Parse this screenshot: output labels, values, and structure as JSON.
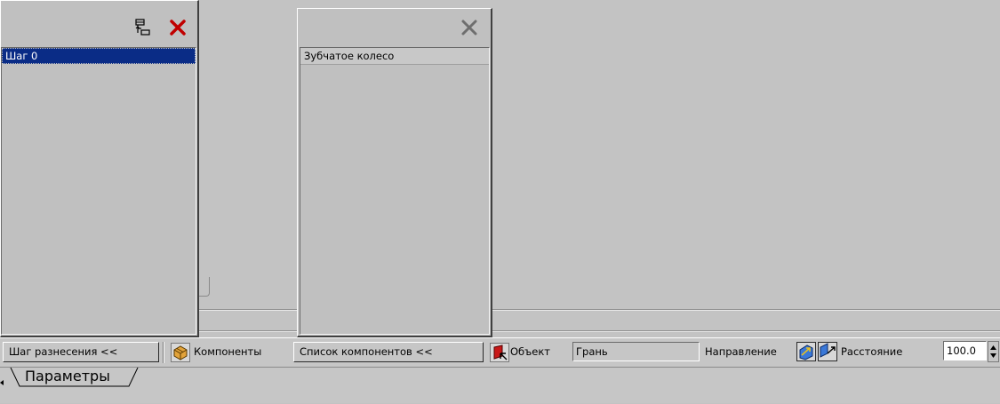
{
  "left_panel": {
    "steps": [
      "Шаг 0"
    ]
  },
  "middle_panel": {
    "items": [
      "Зубчатое колесо"
    ]
  },
  "toolbar": {
    "step_button_label": "Шаг разнесения  <<",
    "components_label": "Компоненты",
    "component_list_button_label": "Список компонентов  <<",
    "object_label": "Объект",
    "object_value": "Грань",
    "direction_label": "Направление",
    "distance_label": "Расстояние",
    "distance_value": "100.0"
  },
  "tabs": [
    "Параметры"
  ],
  "icons": {
    "tree": "tree-structure-icon",
    "close_red": "close-icon",
    "close_gray": "close-icon-disabled",
    "components": "components-cube-icon",
    "object": "object-select-icon",
    "direction_forward": "direction-forward-icon",
    "direction_reverse": "direction-reverse-icon",
    "spinner": "spinner-arrows-icon"
  },
  "colors": {
    "selection": "#0a2c86",
    "close_red": "#c00000",
    "background": "#c3c3c3"
  }
}
